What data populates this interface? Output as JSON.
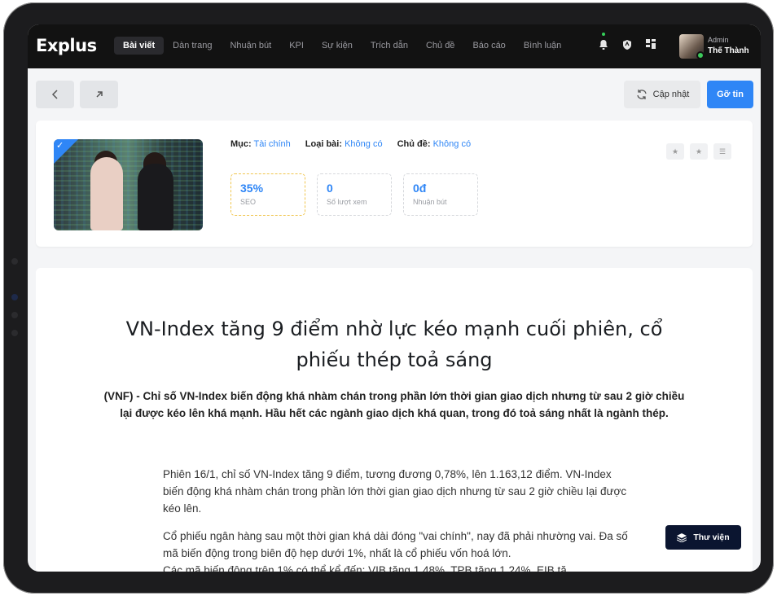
{
  "app": {
    "logo": "Explus"
  },
  "nav": [
    "Bài viết",
    "Dàn trang",
    "Nhuận bút",
    "KPI",
    "Sự kiện",
    "Trích dẫn",
    "Chủ đề",
    "Báo cáo",
    "Bình luận"
  ],
  "user": {
    "role": "Admin",
    "name": "Thế Thành"
  },
  "toolbar": {
    "update_label": "Cập nhật",
    "primary_label": "Gỡ tin"
  },
  "meta": {
    "category_label": "Mục:",
    "category_value": "Tài chính",
    "type_label": "Loại bài:",
    "type_value": "Không có",
    "topic_label": "Chủ đề:",
    "topic_value": "Không có"
  },
  "stats": [
    {
      "value": "35%",
      "label": "SEO"
    },
    {
      "value": "0",
      "label": "Số lượt xem"
    },
    {
      "value": "0đ",
      "label": "Nhuận bút"
    }
  ],
  "article": {
    "title": "VN-Index tăng 9 điểm nhờ lực kéo mạnh cuối phiên, cổ phiếu thép toả sáng",
    "sapo": "(VNF) - Chỉ số VN-Index biến động khá nhàm chán trong phần lớn thời gian giao dịch nhưng từ sau 2 giờ chiều lại được kéo lên khá mạnh. Hầu hết các ngành giao dịch khá quan, trong đó toả sáng nhất là ngành thép.",
    "p1": "Phiên 16/1, chỉ số VN-Index tăng 9 điểm, tương đương 0,78%, lên 1.163,12 điểm. VN-Index biến động khá nhàm chán trong phần lớn thời gian giao dịch nhưng từ sau 2 giờ chiều lại được kéo lên.",
    "p2": "Cổ phiếu ngân hàng sau một thời gian khá dài đóng \"vai chính\", nay đã phải nhường vai. Đa số mã biến động trong biên độ hẹp dưới 1%, nhất là cổ phiếu vốn hoá lớn.",
    "p3": "Các mã biến động trên 1% có thể kể đến: VIB tăng 1,48%, TPB tăng 1,24%, EIB tă..."
  },
  "library_label": "Thư viện",
  "colors": {
    "accent": "#2f86f6",
    "topbar": "#121212",
    "library": "#0b1530"
  }
}
